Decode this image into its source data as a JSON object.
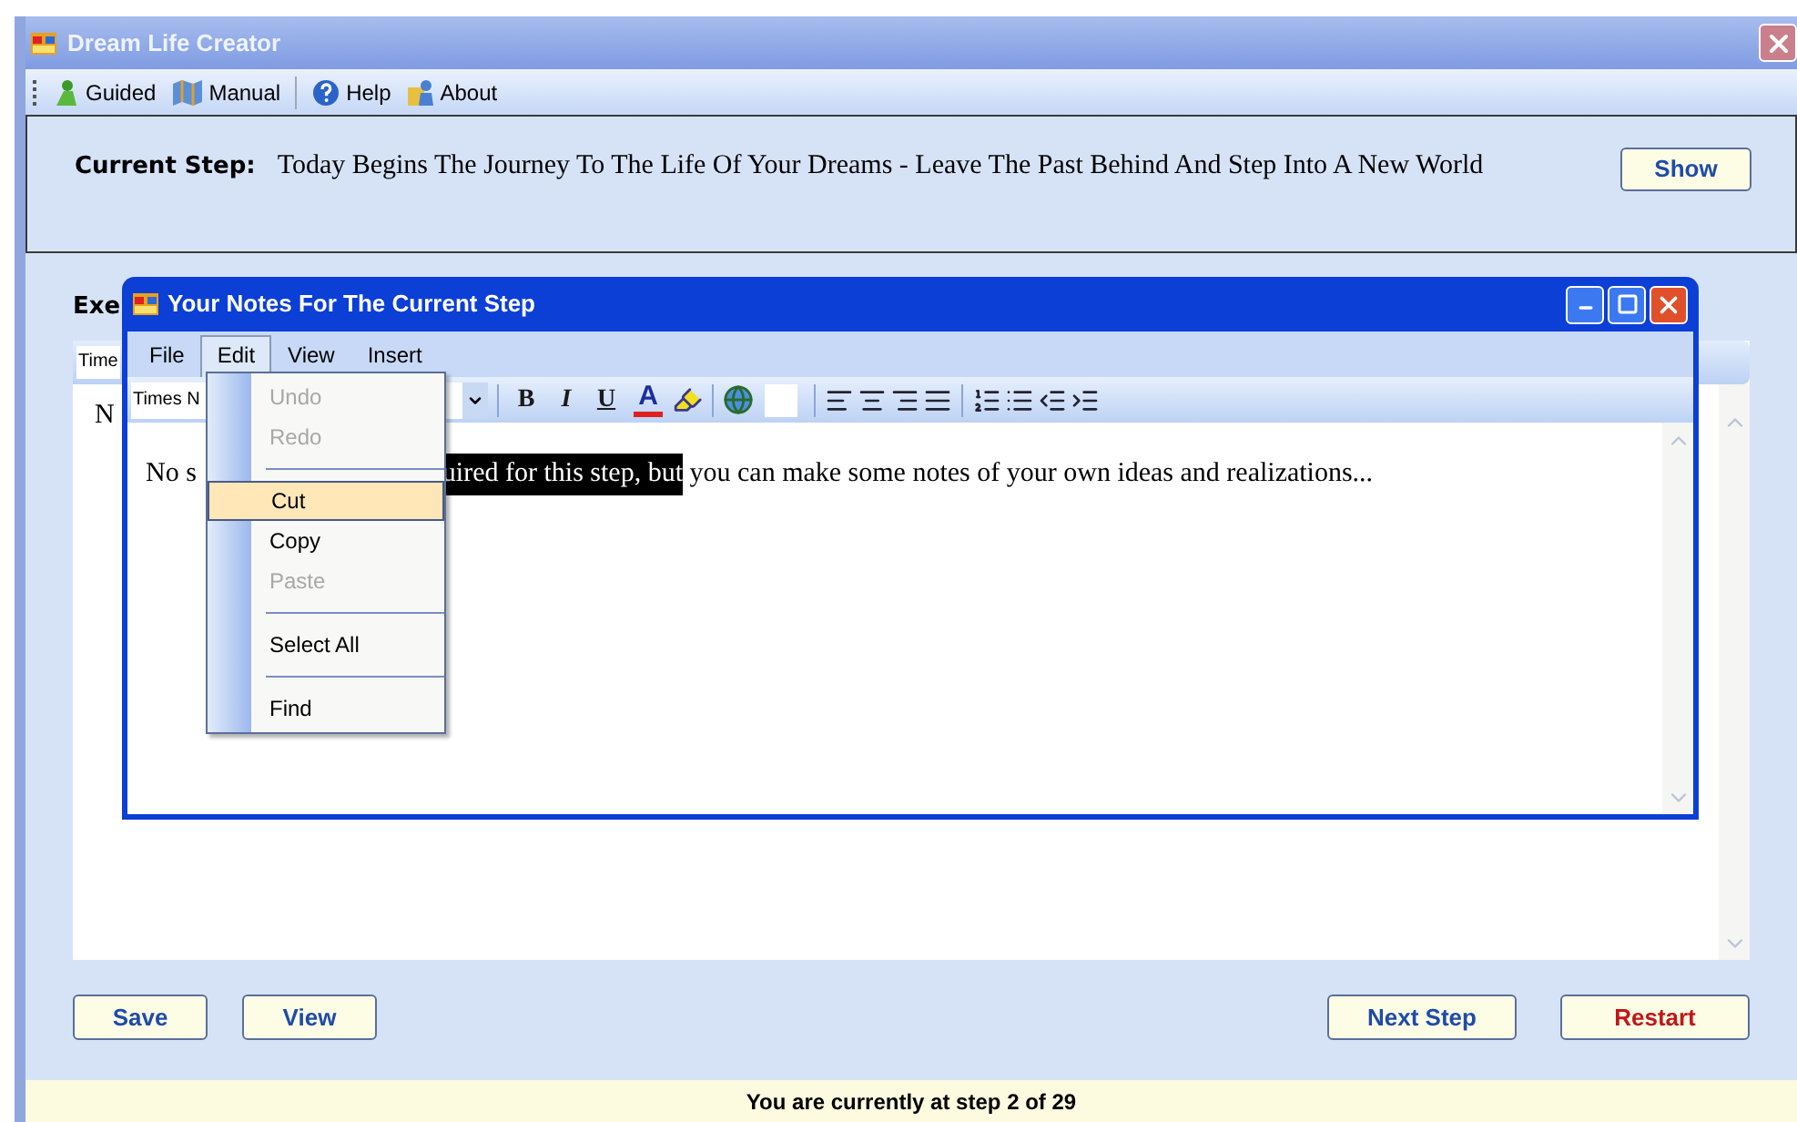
{
  "window": {
    "title": "Dream Life Creator"
  },
  "toolbar": [
    {
      "label": "Guided",
      "kind": "guided"
    },
    {
      "label": "Manual",
      "kind": "manual"
    },
    {
      "label": "Help",
      "kind": "help"
    },
    {
      "label": "About",
      "kind": "about"
    }
  ],
  "current_step": {
    "label": "Current Step:",
    "text": "Today Begins The Journey To The Life Of Your Dreams - Leave The Past Behind And Step Into A New World",
    "button": "Show"
  },
  "exercise": {
    "label": "Exe",
    "font_field": "Time",
    "text": "N"
  },
  "buttons": [
    {
      "label": "Save",
      "kind": "normal"
    },
    {
      "label": "View",
      "kind": "normal"
    },
    {
      "label": "Next Step",
      "kind": "normal"
    },
    {
      "label": "Restart",
      "kind": "danger"
    }
  ],
  "status_bar": "You are currently at step 2 of 29",
  "notes_dialog": {
    "title": "Your Notes For The Current Step",
    "menu": [
      {
        "label": "File",
        "selected": false
      },
      {
        "label": "Edit",
        "selected": true
      },
      {
        "label": "View",
        "selected": false
      },
      {
        "label": "Insert",
        "selected": false
      }
    ],
    "font_field": "Times N",
    "format_buttons": [
      {
        "label": "B",
        "kind": "bold"
      },
      {
        "label": "I",
        "kind": "italic"
      },
      {
        "label": "U",
        "kind": "underline"
      },
      {
        "label": "A",
        "kind": "color"
      }
    ],
    "editor": {
      "text_before": "No s",
      "selected_text": "uired for this step, but",
      "text_after": " you can make some notes of your own ideas and realizations..."
    }
  },
  "edit_menu": [
    {
      "kind": "item",
      "label": "Undo",
      "disabled": true,
      "selected": false
    },
    {
      "kind": "item",
      "label": "Redo",
      "disabled": true,
      "selected": false
    },
    {
      "kind": "separator"
    },
    {
      "kind": "item",
      "label": "Cut",
      "disabled": false,
      "selected": true
    },
    {
      "kind": "item",
      "label": "Copy",
      "disabled": false,
      "selected": false
    },
    {
      "kind": "item",
      "label": "Paste",
      "disabled": true,
      "selected": false
    },
    {
      "kind": "separator"
    },
    {
      "kind": "item",
      "label": "Select All",
      "disabled": false,
      "selected": false
    },
    {
      "kind": "separator"
    },
    {
      "kind": "item",
      "label": "Find",
      "disabled": false,
      "selected": false
    }
  ]
}
